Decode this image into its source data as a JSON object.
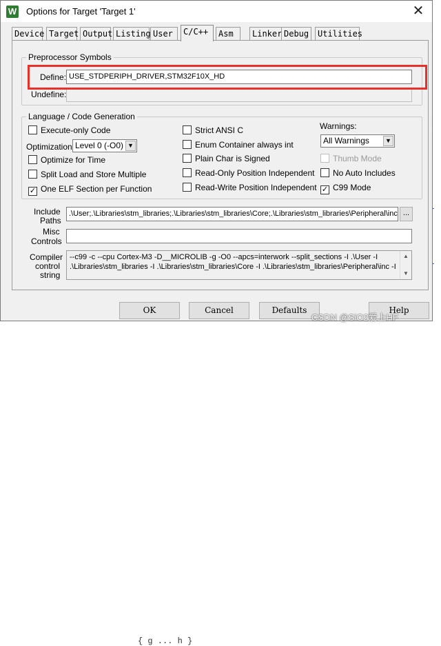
{
  "window": {
    "title": "Options for Target 'Target 1'",
    "icon_letter": "W",
    "close_glyph": "✕"
  },
  "tabs": [
    "Device",
    "Target",
    "Output",
    "Listing",
    "User",
    "C/C++",
    "Asm",
    "Linker",
    "Debug",
    "Utilities"
  ],
  "active_tab": "C/C++",
  "preprocessor": {
    "group_title": "Preprocessor Symbols",
    "define_label": "Define:",
    "define_value": "USE_STDPERIPH_DRIVER,STM32F10X_HD",
    "undefine_label": "Undefine:",
    "undefine_value": ""
  },
  "language": {
    "group_title": "Language / Code Generation",
    "execute_only": {
      "label": "Execute-only Code",
      "checked": false
    },
    "optimization_label": "Optimization:",
    "optimization_value": "Level 0 (-O0)",
    "optimize_time": {
      "label": "Optimize for Time",
      "checked": false
    },
    "split_load": {
      "label": "Split Load and Store Multiple",
      "checked": false
    },
    "one_elf": {
      "label": "One ELF Section per Function",
      "checked": true
    },
    "strict_ansi": {
      "label": "Strict ANSI C",
      "checked": false
    },
    "enum_container": {
      "label": "Enum Container always int",
      "checked": false
    },
    "plain_char": {
      "label": "Plain Char is Signed",
      "checked": false
    },
    "ro_pi": {
      "label": "Read-Only Position Independent",
      "checked": false
    },
    "rw_pi": {
      "label": "Read-Write Position Independent",
      "checked": false
    },
    "warnings_label": "Warnings:",
    "warnings_value": "All Warnings",
    "thumb_mode": {
      "label": "Thumb Mode",
      "checked": false,
      "disabled": true
    },
    "no_auto_includes": {
      "label": "No Auto Includes",
      "checked": false
    },
    "c99_mode": {
      "label": "C99 Mode",
      "checked": true
    }
  },
  "include_paths": {
    "label_line1": "Include",
    "label_line2": "Paths",
    "value": ".\\User;.\\Libraries\\stm_libraries;.\\Libraries\\stm_libraries\\Core;.\\Libraries\\stm_libraries\\Peripheral\\inc;.\\",
    "browse_label": "..."
  },
  "misc_controls": {
    "label_line1": "Misc",
    "label_line2": "Controls",
    "value": ""
  },
  "compiler_control": {
    "label_line1": "Compiler",
    "label_line2": "control",
    "label_line3": "string",
    "line1": "--c99 -c --cpu Cortex-M3 -D__MICROLIB -g -O0 --apcs=interwork --split_sections -I .\\User -I",
    "line2": ".\\Libraries\\stm_libraries -I .\\Libraries\\stm_libraries\\Core -I .\\Libraries\\stm_libraries\\Peripheral\\inc -I"
  },
  "buttons": {
    "ok": "OK",
    "cancel": "Cancel",
    "defaults": "Defaults",
    "help": "Help"
  },
  "watermark": "CSDN @SiO2爱上HF",
  "background": {
    "code_fragment": "{ g ... h }"
  },
  "colors": {
    "highlight": "#e8302a",
    "dialog_bg": "#f0f0f0",
    "icon_bg": "#2e7d32"
  }
}
